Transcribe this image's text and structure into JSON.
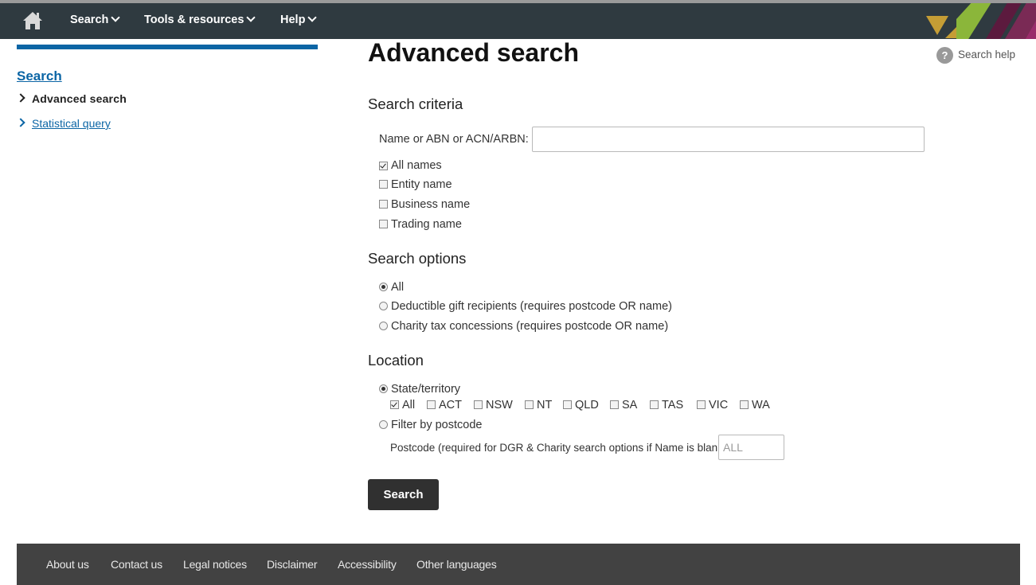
{
  "nav": {
    "home_icon": "home-icon",
    "items": [
      {
        "label": "Search"
      },
      {
        "label": "Tools & resources"
      },
      {
        "label": "Help"
      }
    ],
    "brand_colors": [
      "#c59d35",
      "#8bb63a",
      "#7a2a55",
      "#5c1a3e"
    ]
  },
  "sidebar": {
    "accent_color": "#0b65a5",
    "title": "Search",
    "items": [
      {
        "label": "Advanced search",
        "active": true
      },
      {
        "label": "Statistical query",
        "active": false
      }
    ]
  },
  "main": {
    "title": "Advanced search",
    "help_label": "Search help",
    "criteria": {
      "heading": "Search criteria",
      "name_label": "Name or ABN or ACN/ARBN:",
      "name_value": "",
      "name_types": [
        {
          "label": "All names",
          "checked": true
        },
        {
          "label": "Entity name",
          "checked": false
        },
        {
          "label": "Business name",
          "checked": false
        },
        {
          "label": "Trading name",
          "checked": false
        }
      ]
    },
    "options": {
      "heading": "Search options",
      "items": [
        {
          "label": "All",
          "selected": true
        },
        {
          "label": "Deductible gift recipients (requires postcode OR name)",
          "selected": false
        },
        {
          "label": "Charity tax concessions (requires postcode OR name)",
          "selected": false
        }
      ]
    },
    "location": {
      "heading": "Location",
      "state_label": "State/territory",
      "state_selected": true,
      "states": [
        {
          "label": "All",
          "checked": true
        },
        {
          "label": "ACT",
          "checked": false
        },
        {
          "label": "NSW",
          "checked": false
        },
        {
          "label": "NT",
          "checked": false
        },
        {
          "label": "QLD",
          "checked": false
        },
        {
          "label": "SA",
          "checked": false
        },
        {
          "label": "TAS",
          "checked": false
        },
        {
          "label": "VIC",
          "checked": false
        },
        {
          "label": "WA",
          "checked": false
        }
      ],
      "postcode_filter_label": "Filter by postcode",
      "postcode_filter_selected": false,
      "postcode_label": "Postcode (required for DGR & Charity search options if Name is blank)",
      "postcode_placeholder": "ALL"
    },
    "search_button": "Search"
  },
  "footer": {
    "links": [
      "About us",
      "Contact us",
      "Legal notices",
      "Disclaimer",
      "Accessibility",
      "Other languages"
    ]
  }
}
